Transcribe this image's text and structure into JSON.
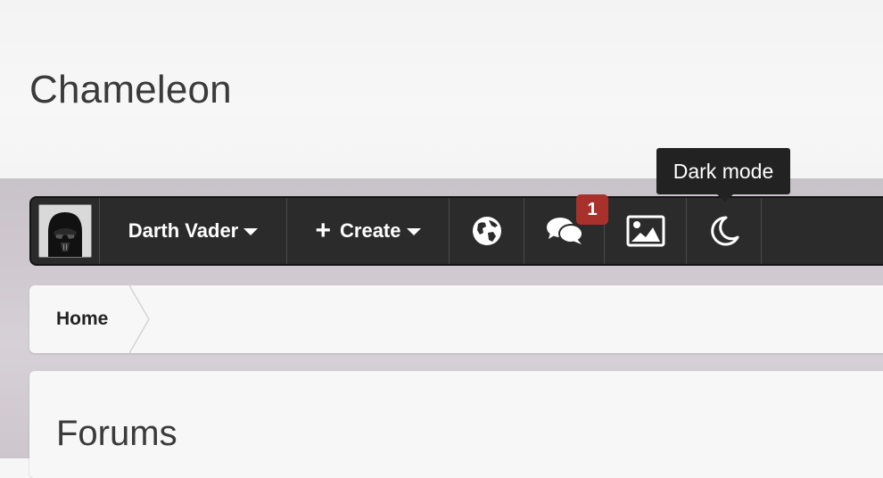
{
  "site": {
    "title": "Chameleon"
  },
  "navbar": {
    "user": {
      "name": "Darth Vader",
      "avatar_icon": "darth-vader-avatar"
    },
    "create": {
      "label": "Create",
      "icon": "plus-icon"
    },
    "icons": [
      {
        "name": "globe-icon"
      },
      {
        "name": "chat-icon",
        "badge": "1"
      },
      {
        "name": "image-icon"
      },
      {
        "name": "moon-icon"
      }
    ],
    "tooltip": "Dark mode"
  },
  "breadcrumb": {
    "items": [
      "Home"
    ]
  },
  "page": {
    "title": "Forums"
  },
  "colors": {
    "navbar": "#2b2b2b",
    "badge": "#a8312c",
    "tooltip": "#222222"
  }
}
